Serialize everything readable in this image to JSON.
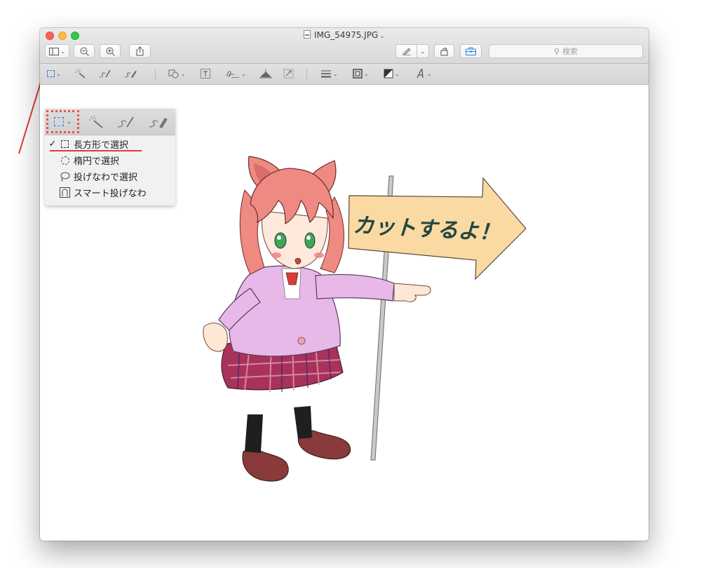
{
  "window": {
    "title": "IMG_54975.JPG",
    "title_chevron": "⌄"
  },
  "toolbar": {
    "sidebar_icon": "sidebar-toggle-icon",
    "zoom_out_icon": "zoom-out-icon",
    "zoom_in_icon": "zoom-in-icon",
    "share_icon": "share-icon",
    "markup_pen_icon": "markup-pen-icon",
    "rotate_icon": "rotate-icon",
    "toolbox_icon": "toolbox-icon",
    "search_placeholder": "検索"
  },
  "markup_tools": [
    "rectangular-selection-icon",
    "instant-alpha-icon",
    "sketch-icon",
    "draw-icon",
    "shapes-icon",
    "text-icon",
    "sign-icon",
    "adjust-color-icon",
    "adjust-size-icon",
    "shape-style-icon",
    "border-color-icon",
    "fill-color-icon",
    "text-style-icon"
  ],
  "selection_menu": {
    "items": [
      {
        "label": "長方形で選択",
        "checked": true,
        "icon": "rectangle-select-icon"
      },
      {
        "label": "楕円で選択",
        "checked": false,
        "icon": "ellipse-select-icon"
      },
      {
        "label": "投げなわで選択",
        "checked": false,
        "icon": "lasso-select-icon"
      },
      {
        "label": "スマート投げなわ",
        "checked": false,
        "icon": "smart-lasso-icon"
      }
    ]
  },
  "image": {
    "sign_text": "カットするよ！"
  },
  "colors": {
    "annotation_red": "#e23b2e",
    "selection_blue": "#3c78f0",
    "sign_fill": "#fad9a3",
    "hair": "#ef8a82",
    "jacket": "#e7b8e8",
    "skirt": "#a8325a",
    "shoes": "#8a3a3a"
  }
}
